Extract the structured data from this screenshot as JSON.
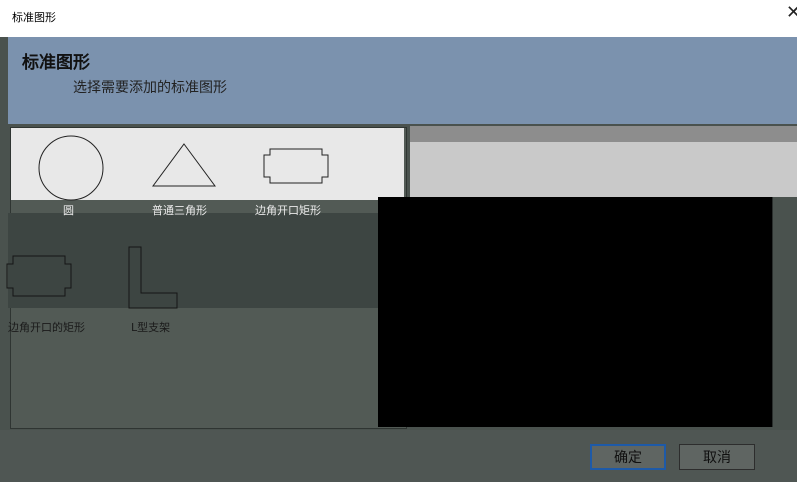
{
  "window": {
    "title": "标准图形"
  },
  "header": {
    "title": "标准图形",
    "subtitle": "选择需要添加的标准图形"
  },
  "shapes": {
    "row1": [
      {
        "label": "圆",
        "icon": "circle-icon"
      },
      {
        "label": "普通三角形",
        "icon": "triangle-icon"
      },
      {
        "label": "边角开口矩形",
        "icon": "notched-rect-icon"
      }
    ],
    "row2": [
      {
        "label": "边角开口的矩形",
        "icon": "notched-rect-icon"
      },
      {
        "label": "L型支架",
        "icon": "l-bracket-icon"
      }
    ]
  },
  "footer": {
    "ok_label": "确定",
    "cancel_label": "取消"
  }
}
